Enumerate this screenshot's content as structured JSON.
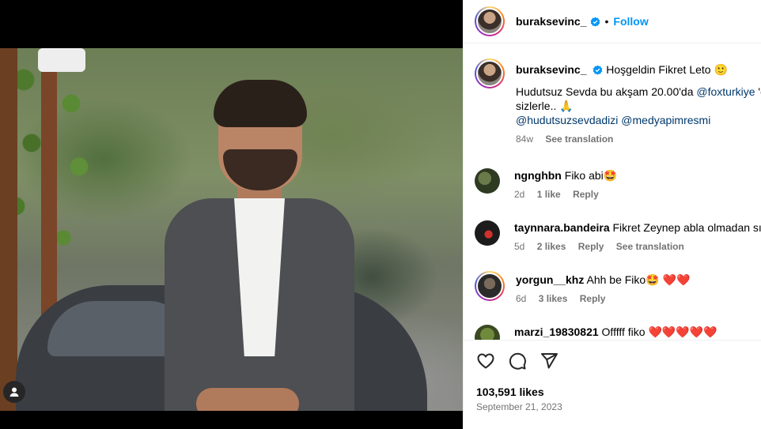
{
  "post": {
    "username": "buraksevinc_",
    "follow_label": "Follow",
    "separator": "•",
    "caption_title": "Hoşgeldin Fikret Leto 🙂",
    "caption_line1_prefix": "Hudutsuz Sevda bu akşam 20.00'da ",
    "caption_mention1": "@foxturkiye",
    "caption_line1_suffix": " 'd",
    "caption_line2": "sizlerle.. 🙏",
    "caption_tag1": "@hudutsuzsevdadizi",
    "caption_tag2": "@medyapimresmi",
    "caption_age": "84w",
    "see_translation": "See translation",
    "likes": "103,591 likes",
    "date": "September 21, 2023"
  },
  "comments": [
    {
      "user": "ngnghbn",
      "text": "Fiko abi🤩",
      "age": "2d",
      "likes": "1 like",
      "reply": "Reply",
      "translate": ""
    },
    {
      "user": "taynnara.bandeira",
      "text": "Fikret Zeynep abla olmadan sık",
      "age": "5d",
      "likes": "2 likes",
      "reply": "Reply",
      "translate": "See translation"
    },
    {
      "user": "yorgun__khz",
      "text": "Ahh be Fiko🤩",
      "age": "6d",
      "likes": "3 likes",
      "reply": "Reply",
      "translate": ""
    },
    {
      "user": "marzi_19830821",
      "text": "Offfff fiko",
      "age": "",
      "likes": "",
      "reply": "",
      "translate": ""
    }
  ],
  "icons": {
    "verified": "verified-badge-icon",
    "like": "heart-icon",
    "comment": "comment-icon",
    "share": "send-icon",
    "tag": "user-tag-icon"
  },
  "colors": {
    "accent": "#0095f6",
    "link": "#00376b",
    "muted": "#737373",
    "heart": "#ed1c24"
  }
}
